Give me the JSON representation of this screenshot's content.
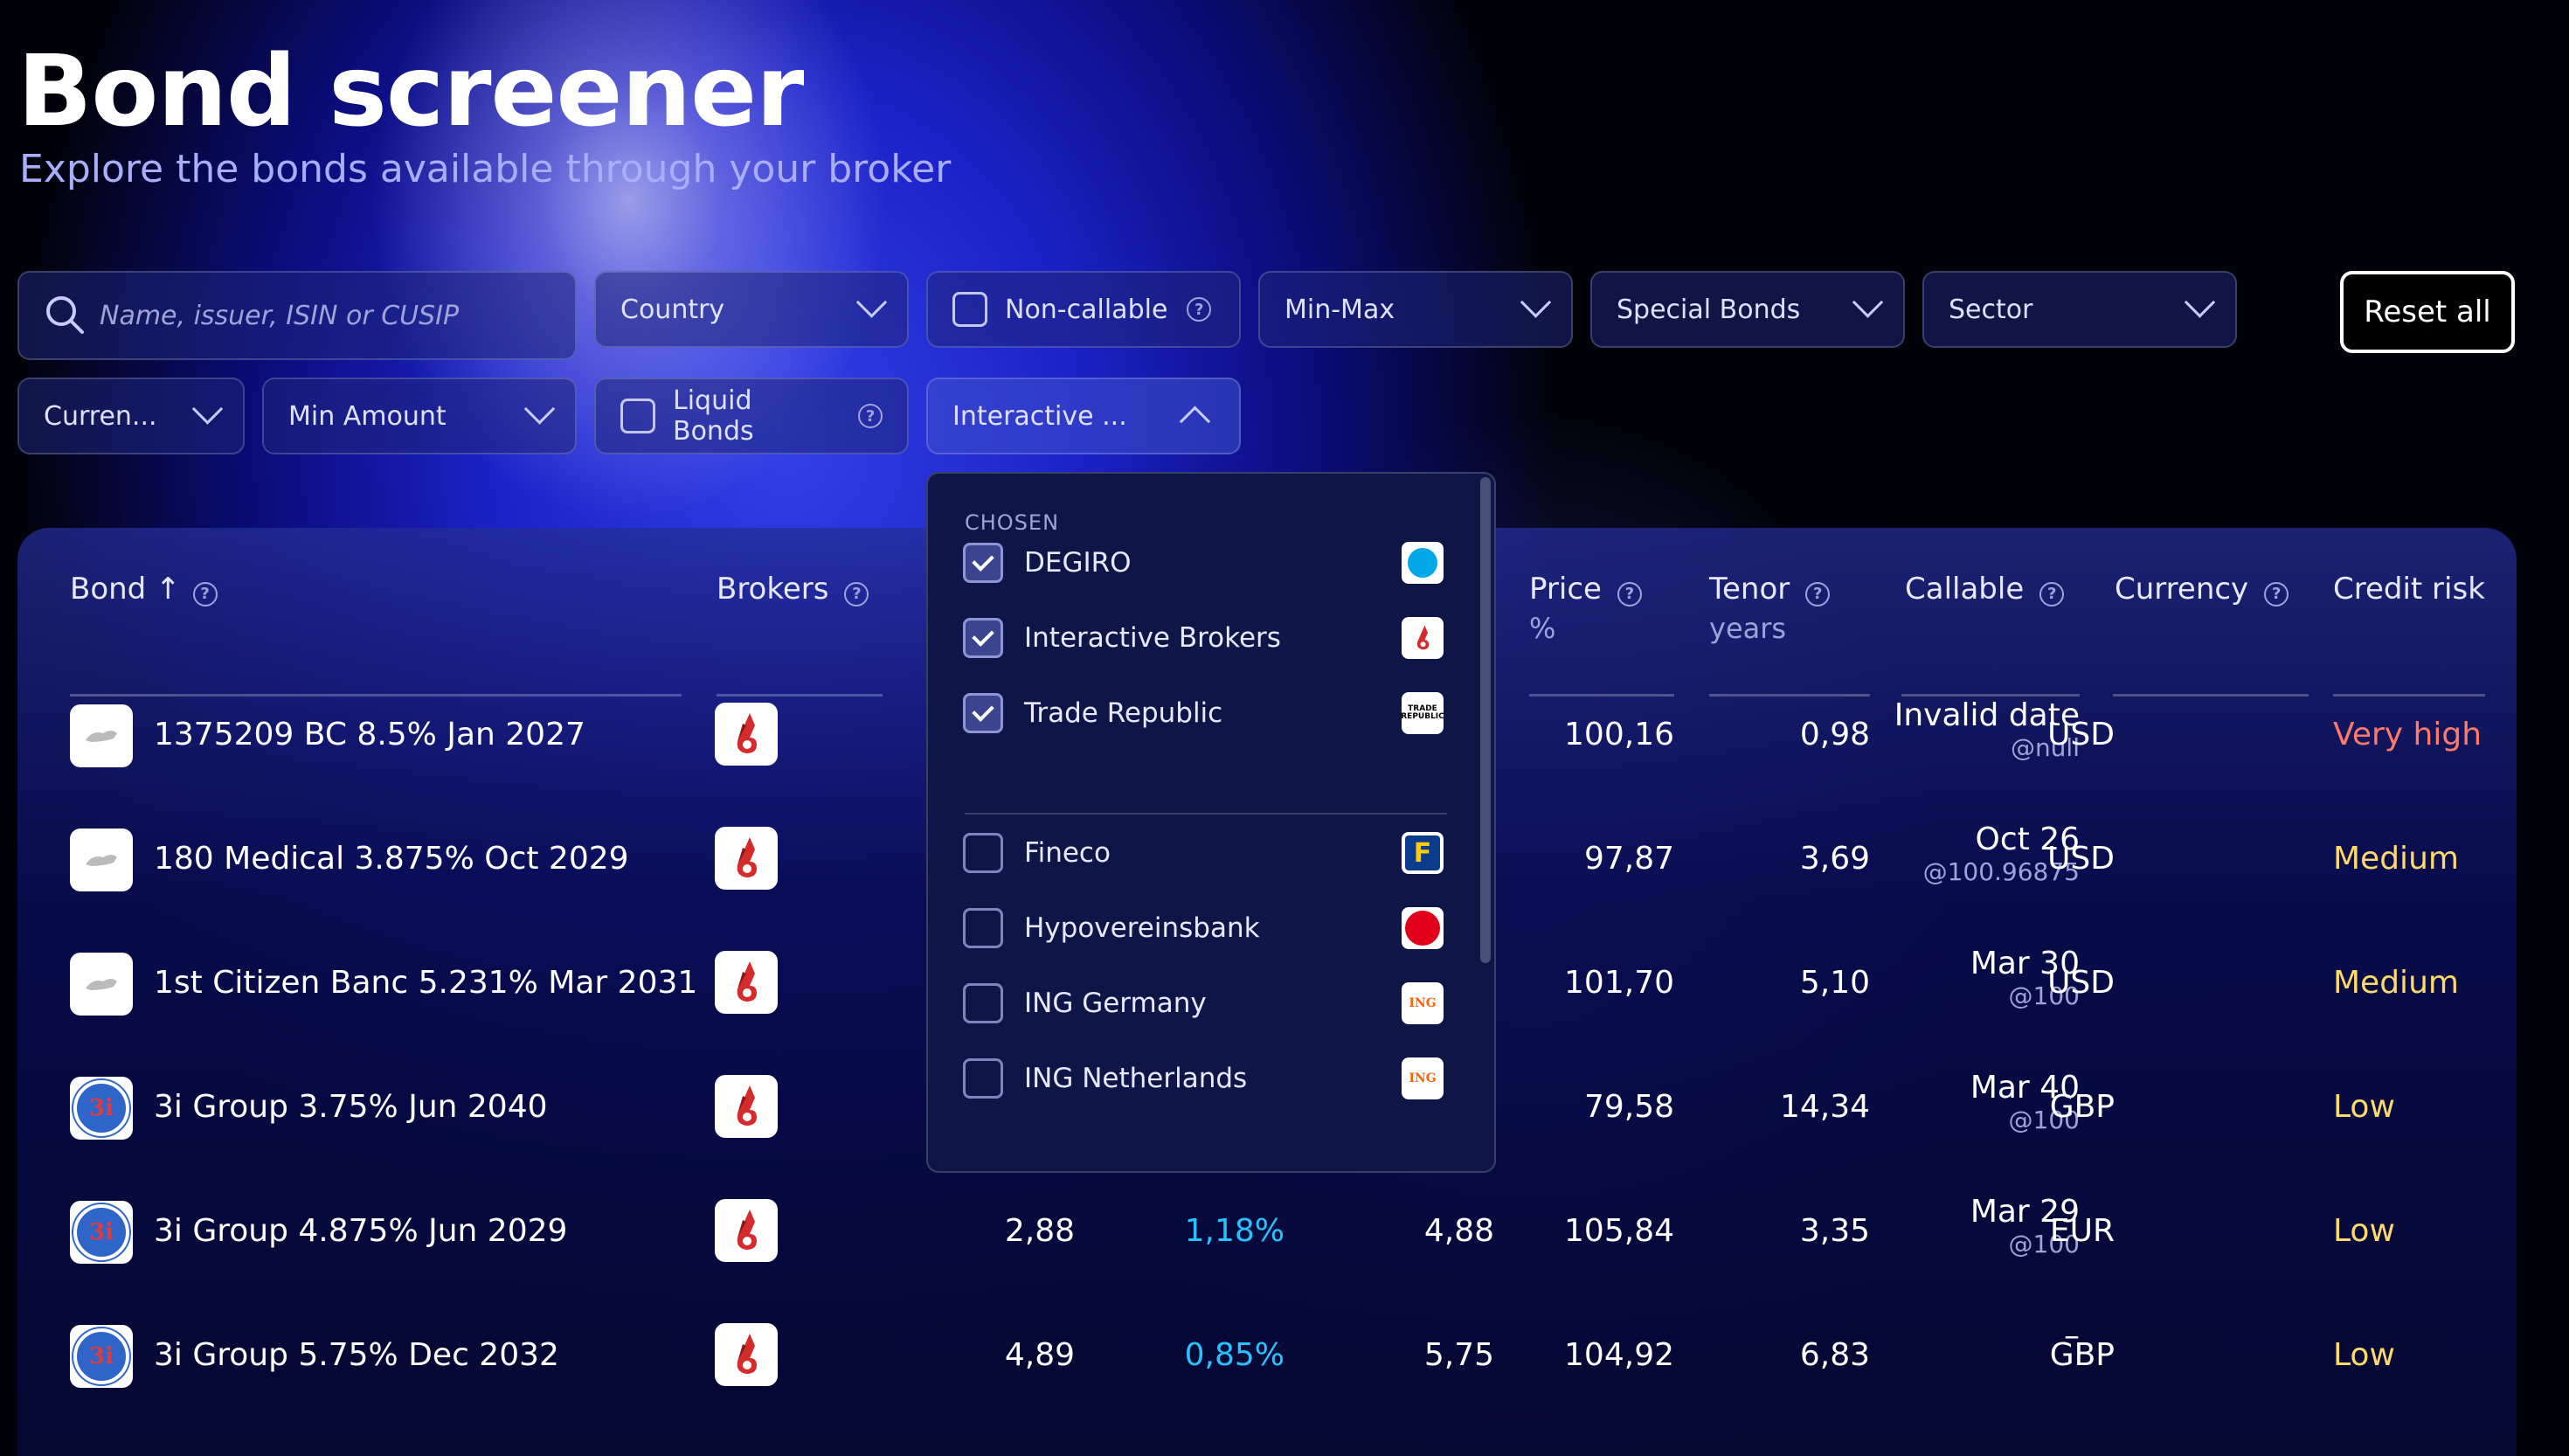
{
  "header": {
    "title": "Bond screener",
    "subtitle": "Explore the bonds available through your broker"
  },
  "filters": {
    "search_placeholder": "Name, issuer, ISIN or CUSIP",
    "country": "Country",
    "non_callable": "Non-callable",
    "min_max": "Min-Max",
    "special_bonds": "Special Bonds",
    "sector": "Sector",
    "currency": "Curren...",
    "min_amount": "Min Amount",
    "liquid_bonds": "Liquid Bonds",
    "broker_selected": "Interactive ...",
    "reset_label": "Reset all"
  },
  "broker_dropdown": {
    "chosen_heading": "CHOSEN",
    "chosen": [
      {
        "label": "DEGIRO",
        "checked": true,
        "logo": "degiro-logo"
      },
      {
        "label": "Interactive Brokers",
        "checked": true,
        "logo": "interactive-brokers-logo"
      },
      {
        "label": "Trade Republic",
        "checked": true,
        "logo": "trade-republic-logo"
      }
    ],
    "others": [
      {
        "label": "Fineco",
        "checked": false,
        "logo": "fineco-logo"
      },
      {
        "label": "Hypovereinsbank",
        "checked": false,
        "logo": "hypovereinsbank-logo"
      },
      {
        "label": "ING Germany",
        "checked": false,
        "logo": "ing-logo"
      },
      {
        "label": "ING Netherlands",
        "checked": false,
        "logo": "ing-logo"
      }
    ]
  },
  "table": {
    "headers": {
      "bond": "Bond ↑",
      "brokers": "Brokers",
      "price": "Price",
      "price_sub": "%",
      "tenor": "Tenor",
      "tenor_sub": "years",
      "callable": "Callable",
      "currency": "Currency",
      "credit_risk": "Credit risk"
    },
    "rows": [
      {
        "name": "1375209 BC 8.5% Jan 2027",
        "c1": "",
        "c2": "",
        "c3": "",
        "price": "100,16",
        "tenor": "0,98",
        "callable": "Invalid date",
        "callable_sub": "@null",
        "currency": "USD",
        "risk": "Very high",
        "risk_color": "#ff7a6b",
        "logo": "generic"
      },
      {
        "name": "180 Medical 3.875% Oct 2029",
        "c1": "",
        "c2": "",
        "c3": "",
        "price": "97,87",
        "tenor": "3,69",
        "callable": "Oct 26",
        "callable_sub": "@100.96875",
        "currency": "USD",
        "risk": "Medium",
        "risk_color": "#ffd96b",
        "logo": "generic"
      },
      {
        "name": "1st Citizen Banc 5.231% Mar 2031",
        "c1": "",
        "c2": "",
        "c3": "",
        "price": "101,70",
        "tenor": "5,10",
        "callable": "Mar 30",
        "callable_sub": "@100",
        "currency": "USD",
        "risk": "Medium",
        "risk_color": "#ffd96b",
        "logo": "generic"
      },
      {
        "name": "3i Group 3.75% Jun 2040",
        "c1": "",
        "c2": "",
        "c3": "",
        "price": "79,58",
        "tenor": "14,34",
        "callable": "Mar 40",
        "callable_sub": "@100",
        "currency": "GBP",
        "risk": "Low",
        "risk_color": "#ffd96b",
        "logo": "3i"
      },
      {
        "name": "3i Group 4.875% Jun 2029",
        "c1": "2,88",
        "c2": "1,18%",
        "c3": "4,88",
        "price": "105,84",
        "tenor": "3,35",
        "callable": "Mar 29",
        "callable_sub": "@100",
        "currency": "EUR",
        "risk": "Low",
        "risk_color": "#ffd96b",
        "logo": "3i"
      },
      {
        "name": "3i Group 5.75% Dec 2032",
        "c1": "4,89",
        "c2": "0,85%",
        "c3": "5,75",
        "price": "104,92",
        "tenor": "6,83",
        "callable": "–",
        "callable_sub": "",
        "currency": "GBP",
        "risk": "Low",
        "risk_color": "#ffd96b",
        "logo": "3i"
      }
    ]
  },
  "colors": {
    "accent": "#27c3ff",
    "panel": "#0e1647"
  }
}
